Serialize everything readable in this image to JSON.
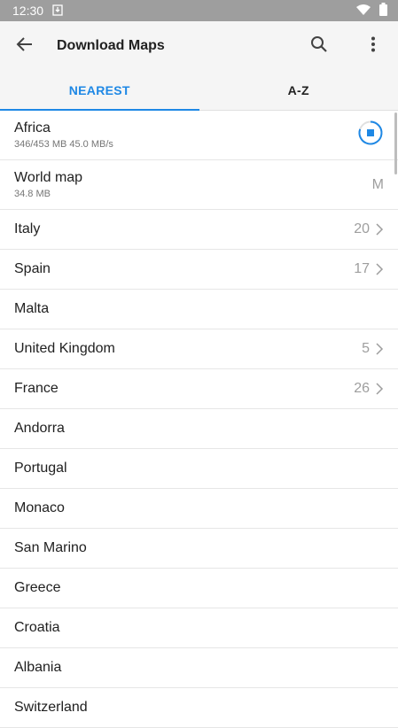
{
  "status_bar": {
    "time": "12:30",
    "icons": [
      "download-notification-icon",
      "wifi-icon",
      "battery-icon"
    ]
  },
  "appbar": {
    "title": "Download Maps",
    "icons": [
      "back-arrow-icon",
      "search-icon",
      "more-vert-icon"
    ]
  },
  "tabs": [
    {
      "label": "NEAREST",
      "active": true
    },
    {
      "label": "A-Z",
      "active": false
    }
  ],
  "colors": {
    "accent": "#1e88e5",
    "appbar_bg": "#f5f5f5",
    "status_bg": "#9e9e9e"
  },
  "list": {
    "africa": {
      "name": "Africa",
      "sub": "346/453 MB 45.0 MB/s",
      "action_icon": "stop-download-icon"
    },
    "world_map": {
      "name": "World map",
      "sub": "34.8 MB",
      "right": "M"
    },
    "italy": {
      "name": "Italy",
      "count": "20"
    },
    "spain": {
      "name": "Spain",
      "count": "17"
    },
    "malta": {
      "name": "Malta"
    },
    "uk": {
      "name": "United Kingdom",
      "count": "5"
    },
    "france": {
      "name": "France",
      "count": "26"
    },
    "andorra": {
      "name": "Andorra"
    },
    "portugal": {
      "name": "Portugal"
    },
    "monaco": {
      "name": "Monaco"
    },
    "san_marino": {
      "name": "San Marino"
    },
    "greece": {
      "name": "Greece"
    },
    "croatia": {
      "name": "Croatia"
    },
    "albania": {
      "name": "Albania"
    },
    "switzerland": {
      "name": "Switzerland"
    }
  }
}
